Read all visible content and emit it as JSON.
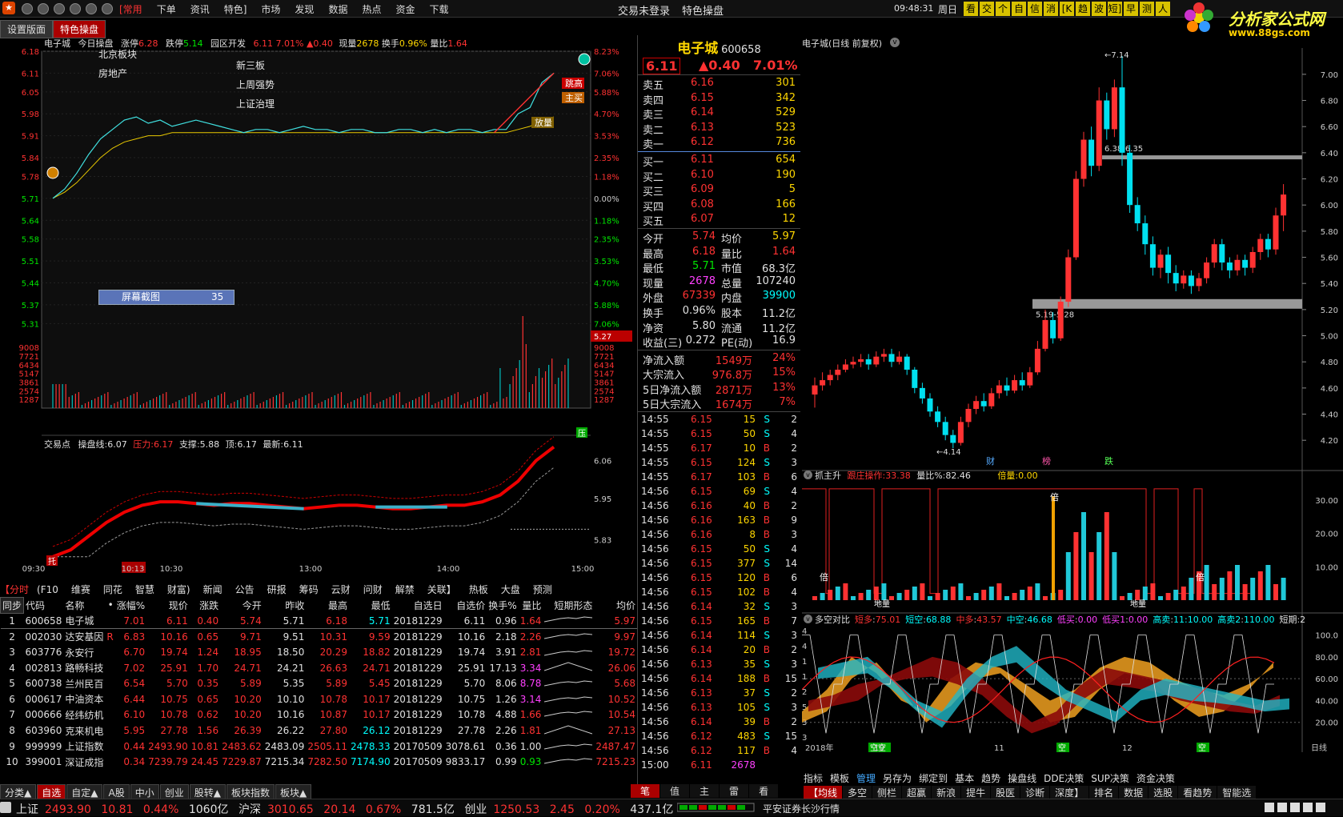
{
  "menu": {
    "logo": "★",
    "items": [
      "[常用",
      "下单",
      "资讯",
      "特色]",
      "市场",
      "发现",
      "数据",
      "热点",
      "资金",
      "下载"
    ],
    "center_items": [
      "交易未登录",
      "特色操盘"
    ],
    "time": "09:48:31",
    "weekday": "周日",
    "toolbar_buttons": [
      "看",
      "交",
      "个",
      "自",
      "信",
      "消",
      "[K",
      "趋",
      "波",
      "短]",
      "早",
      "测",
      "人"
    ],
    "brand": "分析家公式网",
    "brand_url": "www.88gs.com"
  },
  "tabs": [
    "设置版面",
    "特色操盘"
  ],
  "intraday": {
    "header": {
      "name": "电子城",
      "title": "今日操盘",
      "zt_label": "涨停",
      "zt": "6.28",
      "dt_label": "跌停",
      "dt": "5.14",
      "concept": "园区开发",
      "price": "6.11",
      "pct": "7.01%",
      "chg": "▲0.40",
      "vol_label": "现量",
      "vol": "2678",
      "hs_label": "换手",
      "hs": "0.96%",
      "lb_label": "量比",
      "lb": "1.64"
    },
    "left_ticks": [
      "6.18",
      "6.11",
      "6.05",
      "5.98",
      "5.91",
      "5.84",
      "5.78",
      "5.71",
      "5.64",
      "5.58",
      "5.51",
      "5.44",
      "5.37",
      "5.31",
      "9008",
      "7721",
      "6434",
      "5147",
      "3861",
      "2574",
      "1287"
    ],
    "right_ticks": [
      "8.23%",
      "7.06%",
      "5.88%",
      "4.70%",
      "3.53%",
      "2.35%",
      "1.18%",
      "0.00%",
      "1.18%",
      "2.35%",
      "3.53%",
      "4.70%",
      "5.88%",
      "7.06%",
      "9008",
      "7721",
      "6434",
      "5147",
      "3861",
      "2574",
      "1287"
    ],
    "price_tag": "5.27",
    "concepts": [
      "北京板块",
      "房地产",
      "新三板",
      "上周强势",
      "上证治理"
    ],
    "marks": [
      "跳高",
      "主买",
      "放量"
    ],
    "screenshot_label": "屏幕截图",
    "screenshot_count": "35",
    "sub_header": {
      "name": "交易点",
      "l1": "操盘线",
      "v1": "6.07",
      "l2": "压力",
      "v2": "6.17",
      "l3": "支撑",
      "v3": "5.88",
      "l4": "顶",
      "v4": "6.17",
      "l5": "最新",
      "v5": "6.11"
    },
    "sub_ticks": [
      "6.06",
      "5.95",
      "5.83"
    ],
    "sub_marks": [
      "压",
      "托"
    ],
    "times": [
      "09:30",
      "10:13",
      "10:30",
      "13:00",
      "14:00",
      "15:00"
    ]
  },
  "quote": {
    "name": "电子城",
    "code": "600658",
    "price": "6.11",
    "chg": "▲0.40",
    "pct": "7.01%",
    "asks": [
      [
        "卖五",
        "6.16",
        "301"
      ],
      [
        "卖四",
        "6.15",
        "342"
      ],
      [
        "卖三",
        "6.14",
        "529"
      ],
      [
        "卖二",
        "6.13",
        "523"
      ],
      [
        "卖一",
        "6.12",
        "736"
      ]
    ],
    "bids": [
      [
        "买一",
        "6.11",
        "654"
      ],
      [
        "买二",
        "6.10",
        "190"
      ],
      [
        "买三",
        "6.09",
        "5"
      ],
      [
        "买四",
        "6.08",
        "166"
      ],
      [
        "买五",
        "6.07",
        "12"
      ]
    ],
    "stats": [
      [
        "今开",
        "5.74",
        "均价",
        "5.97"
      ],
      [
        "最高",
        "6.18",
        "量比",
        "1.64"
      ],
      [
        "最低",
        "5.71",
        "市值",
        "68.3亿"
      ],
      [
        "现量",
        "2678",
        "总量",
        "107240"
      ],
      [
        "外盘",
        "67339",
        "内盘",
        "39900"
      ],
      [
        "换手",
        "0.96%",
        "股本",
        "11.2亿"
      ],
      [
        "净资",
        "5.80",
        "流通",
        "11.2亿"
      ],
      [
        "收益(三)",
        "0.272",
        "PE(动)",
        "16.9"
      ]
    ],
    "flows": [
      [
        "净流入额",
        "1549万",
        "24%"
      ],
      [
        "大宗流入",
        "976.8万",
        "15%"
      ],
      [
        "5日净流入额",
        "2871万",
        "13%"
      ],
      [
        "5日大宗流入",
        "1674万",
        "7%"
      ]
    ],
    "ticks": [
      [
        "14:55",
        "6.15",
        "15",
        "S",
        "2"
      ],
      [
        "14:55",
        "6.15",
        "50",
        "S",
        "4"
      ],
      [
        "14:55",
        "6.17",
        "10",
        "B",
        "2"
      ],
      [
        "14:55",
        "6.15",
        "124",
        "S",
        "3"
      ],
      [
        "14:55",
        "6.17",
        "103",
        "B",
        "6"
      ],
      [
        "14:56",
        "6.15",
        "69",
        "S",
        "4"
      ],
      [
        "14:56",
        "6.16",
        "40",
        "B",
        "2"
      ],
      [
        "14:56",
        "6.16",
        "163",
        "B",
        "9"
      ],
      [
        "14:56",
        "6.16",
        "8",
        "B",
        "3"
      ],
      [
        "14:56",
        "6.15",
        "50",
        "S",
        "4"
      ],
      [
        "14:56",
        "6.15",
        "377",
        "S",
        "14"
      ],
      [
        "14:56",
        "6.15",
        "120",
        "B",
        "6"
      ],
      [
        "14:56",
        "6.15",
        "102",
        "B",
        "4"
      ],
      [
        "14:56",
        "6.14",
        "32",
        "S",
        "3"
      ],
      [
        "14:56",
        "6.15",
        "165",
        "B",
        "7"
      ],
      [
        "14:56",
        "6.14",
        "114",
        "S",
        "3"
      ],
      [
        "14:56",
        "6.14",
        "20",
        "B",
        "2"
      ],
      [
        "14:56",
        "6.13",
        "35",
        "S",
        "3"
      ],
      [
        "14:56",
        "6.14",
        "188",
        "B",
        "15"
      ],
      [
        "14:56",
        "6.13",
        "37",
        "S",
        "2"
      ],
      [
        "14:56",
        "6.13",
        "105",
        "S",
        "3"
      ],
      [
        "14:56",
        "6.14",
        "39",
        "B",
        "2"
      ],
      [
        "14:56",
        "6.12",
        "483",
        "S",
        "15"
      ],
      [
        "14:56",
        "6.12",
        "117",
        "B",
        "4"
      ],
      [
        "15:00",
        "6.11",
        "2678",
        "",
        ""
      ]
    ]
  },
  "kline": {
    "title": "电子城(日线 前复权)",
    "right_ticks": [
      "7.00",
      "6.80",
      "6.60",
      "6.40",
      "6.20",
      "6.00",
      "5.80",
      "5.60",
      "5.40",
      "5.20",
      "5.00",
      "4.80",
      "4.60",
      "4.40",
      "4.20"
    ],
    "high_label": "7.14",
    "low_label": "4.14",
    "zone1": "6.38-6.35",
    "zone2": "5.19-5.28",
    "events": [
      "财",
      "榜",
      "跌"
    ],
    "ind1": {
      "name": "抓主升",
      "l1": "跟庄操作",
      "v1": "33.38",
      "l2": "量比%",
      "v2": "82.46",
      "l3": "倍量",
      "v3": "0.00",
      "ticks": [
        "30.00",
        "20.00",
        "10.00"
      ],
      "marks": [
        "倍",
        "倍",
        "倍",
        "倍"
      ],
      "bottom_marks": [
        "地量",
        "地量"
      ]
    },
    "ind2": {
      "name": "多空对比",
      "items": [
        [
          "短多",
          "75.01"
        ],
        [
          "短空",
          "68.88"
        ],
        [
          "中多",
          "43.57"
        ],
        [
          "中空",
          "46.68"
        ],
        [
          "低买",
          "0.00"
        ],
        [
          "低买1",
          "0.00"
        ],
        [
          "高卖",
          "11:10.00"
        ],
        [
          "高卖2",
          "110.00"
        ],
        [
          "短期",
          "2"
        ]
      ],
      "ticks": [
        "100.0",
        "80.00",
        "60.00",
        "40.00",
        "20.00"
      ],
      "left_ticks": [
        "4",
        "4",
        "1",
        "1",
        "2",
        "5",
        "3",
        "3"
      ],
      "marks": [
        "空空",
        "空",
        "空",
        "空"
      ]
    },
    "xaxis": [
      "2018年",
      "10",
      "11",
      "12"
    ],
    "xaxis_right": "日线",
    "bottom_menu": [
      "指标",
      "模板",
      "管理",
      "另存为",
      "绑定到",
      "基本",
      "趋势",
      "操盘线",
      "DDE决策",
      "SUP决策",
      "资金决策"
    ],
    "bottom_tabs": [
      "【均线",
      "多空",
      "侧栏",
      "超赢",
      "新浪",
      "提牛",
      "股医",
      "诊断",
      "深度】",
      "排名",
      "数据",
      "选股",
      "看趋势",
      "智能选"
    ]
  },
  "stocklist": {
    "nav": [
      "【分时",
      "(F10",
      "维赛",
      "同花",
      "智慧",
      "财富)",
      "新闻",
      "公告",
      "研报",
      "筹码",
      "云财",
      "问财",
      "解禁",
      "关联】",
      "热板",
      "大盘",
      "预测"
    ],
    "cols": [
      "同步",
      "代码",
      "名称",
      "•",
      "涨幅%",
      "现价",
      "涨跌",
      "今开",
      "昨收",
      "最高",
      "最低",
      "自选日",
      "自选价",
      "换手%",
      "量比",
      "短期形态",
      "均价"
    ],
    "rows": [
      [
        "1",
        "600658",
        "电子城",
        "",
        "7.01",
        "6.11",
        "0.40",
        "5.74",
        "5.71",
        "6.18",
        "5.71",
        "20181229",
        "6.11",
        "0.96",
        "1.64",
        "",
        "5.97"
      ],
      [
        "2",
        "002030",
        "达安基因",
        "R",
        "6.83",
        "10.16",
        "0.65",
        "9.71",
        "9.51",
        "10.31",
        "9.59",
        "20181229",
        "10.16",
        "2.18",
        "2.26",
        "",
        "9.97"
      ],
      [
        "3",
        "603776",
        "永安行",
        "",
        "6.70",
        "19.74",
        "1.24",
        "18.95",
        "18.50",
        "20.29",
        "18.82",
        "20181229",
        "19.74",
        "3.91",
        "2.81",
        "",
        "19.72"
      ],
      [
        "4",
        "002813",
        "路畅科技",
        "",
        "7.02",
        "25.91",
        "1.70",
        "24.71",
        "24.21",
        "26.63",
        "24.71",
        "20181229",
        "25.91",
        "17.13",
        "3.34",
        "",
        "26.06"
      ],
      [
        "5",
        "600738",
        "兰州民百",
        "",
        "6.54",
        "5.70",
        "0.35",
        "5.89",
        "5.35",
        "5.89",
        "5.45",
        "20181229",
        "5.70",
        "8.06",
        "8.78",
        "",
        "5.68"
      ],
      [
        "6",
        "000617",
        "中油资本",
        "",
        "6.44",
        "10.75",
        "0.65",
        "10.20",
        "10.10",
        "10.78",
        "10.17",
        "20181229",
        "10.75",
        "1.26",
        "3.14",
        "",
        "10.52"
      ],
      [
        "7",
        "000666",
        "经纬纺机",
        "",
        "6.10",
        "10.78",
        "0.62",
        "10.20",
        "10.16",
        "10.87",
        "10.17",
        "20181229",
        "10.78",
        "4.88",
        "1.66",
        "",
        "10.54"
      ],
      [
        "8",
        "603960",
        "克来机电",
        "",
        "5.95",
        "27.78",
        "1.56",
        "26.39",
        "26.22",
        "27.80",
        "26.12",
        "20181229",
        "27.78",
        "2.26",
        "1.81",
        "",
        "27.13"
      ],
      [
        "9",
        "999999",
        "上证指数",
        "",
        "0.44",
        "2493.90",
        "10.81",
        "2483.62",
        "2483.09",
        "2505.11",
        "2478.33",
        "20170509",
        "3078.61",
        "0.36",
        "1.00",
        "",
        "2487.47"
      ],
      [
        "10",
        "399001",
        "深证成指",
        "",
        "0.34",
        "7239.79",
        "24.45",
        "7229.87",
        "7215.34",
        "7282.50",
        "7174.90",
        "20170509",
        "9833.17",
        "0.99",
        "0.93",
        "",
        "7215.23"
      ]
    ],
    "bottom_tabs": [
      "分类▲",
      "自选",
      "自定▲",
      "A股",
      "中小",
      "创业",
      "股转▲",
      "板块指数",
      "板块▲"
    ]
  },
  "bottom_tabs_mid": [
    "笔",
    "值",
    "主",
    "雷",
    "看"
  ],
  "status": {
    "sh_label": "上证",
    "sh": "2493.90",
    "sh_chg": "10.81",
    "sh_pct": "0.44%",
    "sh_amt": "1060亿",
    "hs_label": "沪深",
    "hs": "3010.65",
    "hs_chg": "20.14",
    "hs_pct": "0.67%",
    "hs_amt": "781.5亿",
    "cy_label": "创业",
    "cy": "1250.53",
    "cy_chg": "2.45",
    "cy_pct": "0.20%",
    "cy_amt": "437.1亿",
    "broker": "平安证券长沙行情"
  },
  "chart_data": [
    {
      "type": "line",
      "name": "intraday",
      "x_range": [
        "09:30",
        "15:00"
      ],
      "ylim": [
        5.27,
        6.18
      ],
      "price": [
        5.71,
        5.74,
        5.79,
        5.85,
        5.9,
        5.93,
        5.96,
        5.97,
        5.95,
        5.96,
        5.94,
        5.95,
        5.96,
        5.95,
        5.94,
        5.93,
        5.92,
        5.93,
        5.93,
        5.92,
        5.93,
        5.94,
        5.93,
        5.93,
        5.92,
        5.93,
        5.93,
        5.92,
        5.92,
        5.93,
        5.93,
        5.92,
        5.93,
        5.92,
        5.93,
        5.93,
        5.92,
        5.93,
        5.93,
        5.98,
        6.0,
        6.08,
        6.11
      ],
      "avg": [
        5.71,
        5.73,
        5.76,
        5.8,
        5.84,
        5.87,
        5.89,
        5.9,
        5.91,
        5.91,
        5.92,
        5.92,
        5.92,
        5.92,
        5.92,
        5.92,
        5.92,
        5.92,
        5.92,
        5.92,
        5.92,
        5.92,
        5.92,
        5.92,
        5.92,
        5.92,
        5.92,
        5.92,
        5.92,
        5.92,
        5.92,
        5.92,
        5.92,
        5.92,
        5.92,
        5.92,
        5.92,
        5.92,
        5.92,
        5.93,
        5.94,
        5.96,
        5.97
      ]
    },
    {
      "type": "bar",
      "name": "kline-daily",
      "ylim": [
        4.14,
        7.14
      ],
      "candles": [
        [
          4.55,
          4.62,
          4.45,
          4.68
        ],
        [
          4.62,
          4.66,
          4.58,
          4.72
        ],
        [
          4.66,
          4.7,
          4.62,
          4.74
        ],
        [
          4.7,
          4.74,
          4.66,
          4.78
        ],
        [
          4.74,
          4.78,
          4.72,
          4.82
        ],
        [
          4.78,
          4.8,
          4.75,
          4.84
        ],
        [
          4.8,
          4.82,
          4.76,
          4.86
        ],
        [
          4.82,
          4.78,
          4.74,
          4.86
        ],
        [
          4.78,
          4.84,
          4.76,
          4.88
        ],
        [
          4.84,
          4.86,
          4.8,
          4.9
        ],
        [
          4.86,
          4.8,
          4.76,
          4.9
        ],
        [
          4.8,
          4.84,
          4.78,
          4.88
        ],
        [
          4.84,
          4.74,
          4.7,
          4.86
        ],
        [
          4.74,
          4.6,
          4.56,
          4.76
        ],
        [
          4.6,
          4.52,
          4.48,
          4.64
        ],
        [
          4.52,
          4.42,
          4.38,
          4.56
        ],
        [
          4.42,
          4.34,
          4.3,
          4.46
        ],
        [
          4.34,
          4.24,
          4.2,
          4.38
        ],
        [
          4.24,
          4.18,
          4.14,
          4.28
        ],
        [
          4.18,
          4.34,
          4.16,
          4.38
        ],
        [
          4.34,
          4.44,
          4.3,
          4.48
        ],
        [
          4.44,
          4.5,
          4.4,
          4.54
        ],
        [
          4.5,
          4.46,
          4.42,
          4.56
        ],
        [
          4.46,
          4.56,
          4.44,
          4.6
        ],
        [
          4.56,
          4.62,
          4.52,
          4.66
        ],
        [
          4.62,
          4.58,
          4.54,
          4.68
        ],
        [
          4.58,
          4.66,
          4.56,
          4.7
        ],
        [
          4.66,
          4.62,
          4.58,
          4.72
        ],
        [
          4.62,
          4.72,
          4.6,
          4.76
        ],
        [
          4.72,
          4.9,
          4.7,
          4.96
        ],
        [
          4.9,
          5.12,
          4.88,
          5.2
        ],
        [
          5.12,
          4.98,
          4.94,
          5.18
        ],
        [
          4.98,
          5.26,
          4.96,
          5.3
        ],
        [
          5.26,
          5.6,
          5.22,
          5.66
        ],
        [
          5.6,
          6.2,
          5.58,
          6.26
        ],
        [
          6.2,
          6.5,
          6.14,
          6.56
        ],
        [
          6.5,
          6.3,
          6.22,
          6.6
        ],
        [
          6.3,
          6.8,
          6.26,
          6.9
        ],
        [
          6.8,
          6.58,
          6.5,
          6.86
        ],
        [
          6.58,
          6.9,
          6.52,
          6.96
        ],
        [
          6.9,
          6.4,
          6.3,
          7.14
        ],
        [
          6.4,
          6.0,
          5.94,
          6.46
        ],
        [
          6.0,
          5.86,
          5.8,
          6.06
        ],
        [
          5.86,
          5.7,
          5.62,
          5.92
        ],
        [
          5.7,
          5.52,
          5.46,
          5.76
        ],
        [
          5.52,
          5.62,
          5.44,
          5.66
        ],
        [
          5.62,
          5.48,
          5.4,
          5.68
        ],
        [
          5.48,
          5.4,
          5.34,
          5.54
        ],
        [
          5.4,
          5.46,
          5.36,
          5.5
        ],
        [
          5.46,
          5.38,
          5.32,
          5.5
        ],
        [
          5.38,
          5.44,
          5.34,
          5.48
        ],
        [
          5.44,
          5.56,
          5.4,
          5.6
        ],
        [
          5.56,
          5.7,
          5.52,
          5.74
        ],
        [
          5.7,
          5.56,
          5.5,
          5.74
        ],
        [
          5.56,
          5.5,
          5.44,
          5.6
        ],
        [
          5.5,
          5.58,
          5.46,
          5.62
        ],
        [
          5.58,
          5.52,
          5.46,
          5.62
        ],
        [
          5.52,
          5.64,
          5.48,
          5.68
        ],
        [
          5.64,
          5.74,
          5.58,
          5.78
        ],
        [
          5.74,
          5.66,
          5.6,
          5.78
        ],
        [
          5.66,
          5.92,
          5.62,
          5.98
        ],
        [
          5.92,
          6.08,
          5.8,
          6.16
        ]
      ]
    }
  ]
}
